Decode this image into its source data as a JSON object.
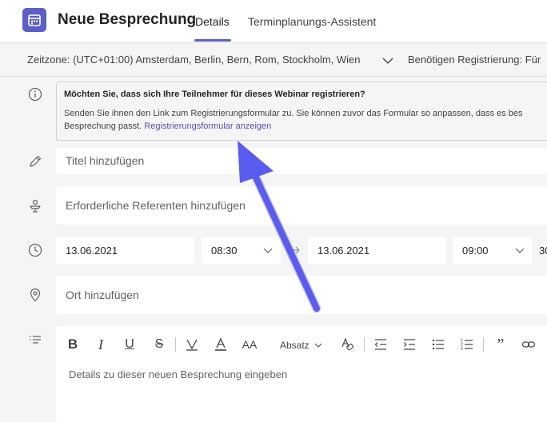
{
  "header": {
    "title": "Neue Besprechung",
    "tabs": [
      {
        "label": "Details",
        "active": true
      },
      {
        "label": "Terminplanungs-Assistent",
        "active": false
      }
    ],
    "accent_color": "#5b5fc7"
  },
  "options_row": {
    "timezone_label": "Zeitzone: (UTC+01:00) Amsterdam, Berlin, Bern, Rom, Stockholm, Wien",
    "registration_label": "Benötigen Registrierung: Für"
  },
  "info": {
    "title": "Möchten Sie, dass sich Ihre Teilnehmer für dieses Webinar registrieren?",
    "body_line1": "Senden Sie ihnen den Link zum Registrierungsformular zu. Sie können zuvor das Formular so anpassen, dass es bes",
    "body_line2": "Besprechung passt.",
    "link_text": "Registrierungsformular anzeigen"
  },
  "form": {
    "title_placeholder": "Titel hinzufügen",
    "presenters_placeholder": "Erforderliche Referenten hinzufügen",
    "start_date": "13.06.2021",
    "start_time": "08:30",
    "end_date": "13.06.2021",
    "end_time": "09:00",
    "duration_partial": "30",
    "location_placeholder": "Ort hinzufügen"
  },
  "editor": {
    "paragraph_style": "Absatz",
    "placeholder": "Details zu dieser neuen Besprechung eingeben"
  },
  "icons": [
    "calendar-icon",
    "info-icon",
    "pencil-icon",
    "presenter-icon",
    "clock-icon",
    "location-icon",
    "details-list-icon",
    "chevron-down-icon",
    "arrow-right-icon"
  ],
  "annotation": {
    "color": "#5a5cf0"
  }
}
